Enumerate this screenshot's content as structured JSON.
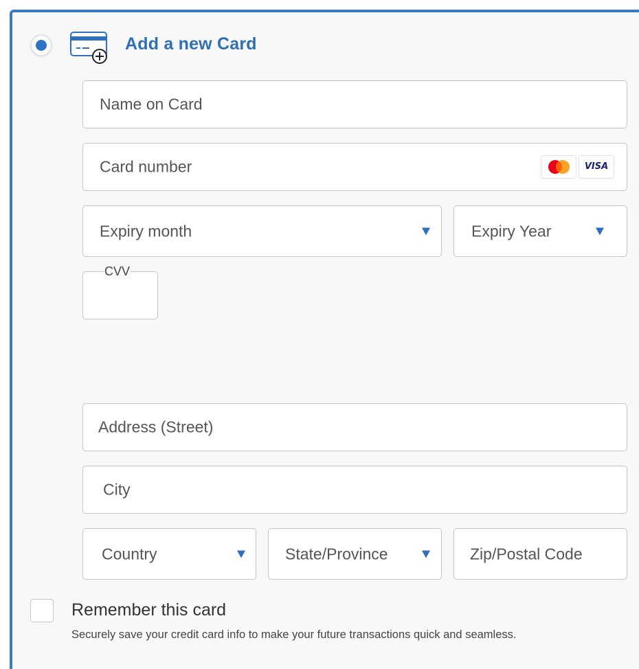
{
  "section": {
    "title": "Add a new Card",
    "selected": true
  },
  "card": {
    "name_placeholder": "Name on Card",
    "number_placeholder": "Card number",
    "expiry_month_placeholder": "Expiry month",
    "expiry_year_placeholder": "Expiry Year",
    "cvv_label": "CVV",
    "accepted_brands": [
      "mastercard",
      "VISA"
    ]
  },
  "address": {
    "street_placeholder": "Address (Street)",
    "city_placeholder": "City",
    "country_placeholder": "Country",
    "state_placeholder": "State/Province",
    "zip_placeholder": "Zip/Postal Code"
  },
  "remember": {
    "label": "Remember this card",
    "description": "Securely save your credit card info to make your future transactions quick and seamless.",
    "checked": false
  },
  "icons": {
    "radio": "radio-selected-icon",
    "card": "credit-card-add-icon",
    "select": "caret-down-icon"
  },
  "colors": {
    "accent": "#2f73c5",
    "heading": "#2e6fb5",
    "panel_border": "#3a7bbf",
    "panel_background": "#f8f8f8"
  }
}
